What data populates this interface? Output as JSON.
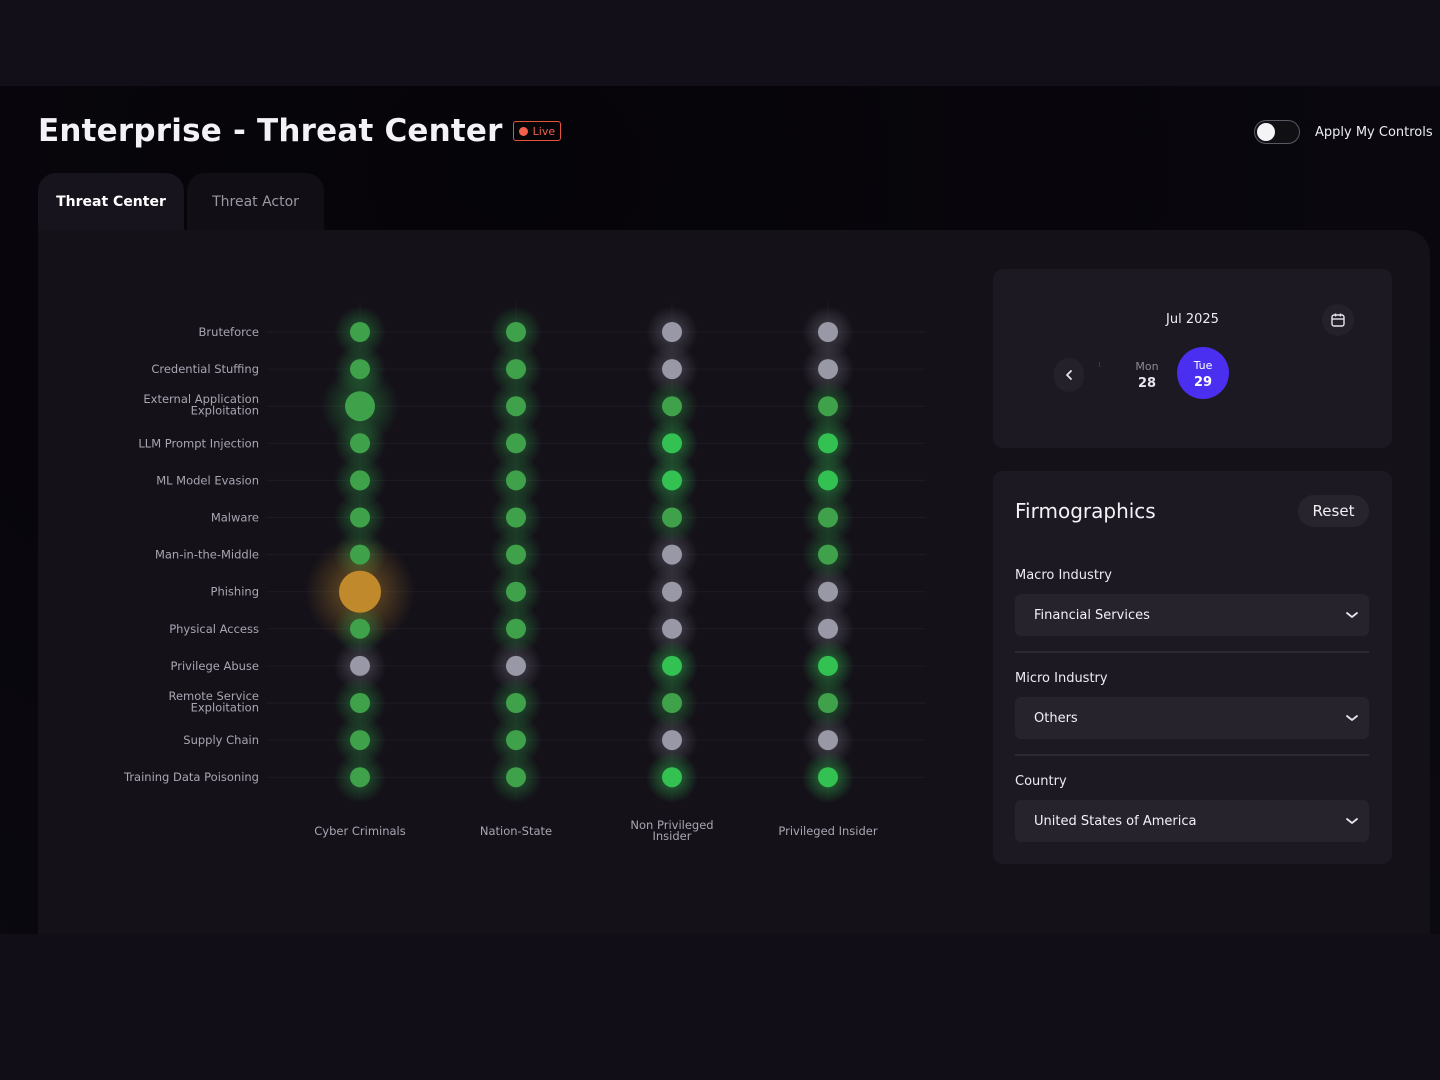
{
  "header": {
    "title": "Enterprise - Threat Center",
    "live_badge": "Live",
    "toggle_label": "Apply My Controls",
    "toggle_on": false
  },
  "tabs": [
    {
      "label": "Threat Center",
      "active": true
    },
    {
      "label": "Threat Actor",
      "active": false
    }
  ],
  "date_picker": {
    "month": "Jul 2025",
    "days": [
      {
        "name": "Mon",
        "num": "28",
        "selected": false
      },
      {
        "name": "Tue",
        "num": "29",
        "selected": true
      }
    ]
  },
  "firmographics": {
    "title": "Firmographics",
    "reset_label": "Reset",
    "fields": [
      {
        "label": "Macro Industry",
        "value": "Financial Services"
      },
      {
        "label": "Micro Industry",
        "value": "Others"
      },
      {
        "label": "Country",
        "value": "United States of America"
      }
    ]
  },
  "colors": {
    "green": "#3fa14a",
    "bright_green": "#33c152",
    "gray": "#9998a6",
    "amber": "#c08a2c",
    "accent": "#4a2ff0",
    "live": "#f0614a"
  },
  "chart_data": {
    "type": "scatter",
    "rows": [
      "Bruteforce",
      "Credential Stuffing",
      [
        "External Application",
        "Exploitation"
      ],
      "LLM Prompt Injection",
      "ML Model Evasion",
      "Malware",
      "Man-in-the-Middle",
      "Phishing",
      "Physical Access",
      "Privilege Abuse",
      [
        "Remote Service",
        "Exploitation"
      ],
      "Supply Chain",
      "Training Data Poisoning"
    ],
    "columns": [
      "Cyber Criminals",
      "Nation-State",
      [
        "Non Privileged",
        "Insider"
      ],
      "Privileged Insider"
    ],
    "cells": [
      [
        {
          "s": "green",
          "size": 1
        },
        {
          "s": "green",
          "size": 1
        },
        {
          "s": "gray",
          "size": 1
        },
        {
          "s": "gray",
          "size": 1
        }
      ],
      [
        {
          "s": "green",
          "size": 1
        },
        {
          "s": "green",
          "size": 1
        },
        {
          "s": "gray",
          "size": 1
        },
        {
          "s": "gray",
          "size": 1
        }
      ],
      [
        {
          "s": "green",
          "size": 1.5
        },
        {
          "s": "green",
          "size": 1
        },
        {
          "s": "green",
          "size": 1
        },
        {
          "s": "green",
          "size": 1
        }
      ],
      [
        {
          "s": "green",
          "size": 1
        },
        {
          "s": "green",
          "size": 1
        },
        {
          "s": "bright_green",
          "size": 1
        },
        {
          "s": "bright_green",
          "size": 1
        }
      ],
      [
        {
          "s": "green",
          "size": 1
        },
        {
          "s": "green",
          "size": 1
        },
        {
          "s": "bright_green",
          "size": 1
        },
        {
          "s": "bright_green",
          "size": 1
        }
      ],
      [
        {
          "s": "green",
          "size": 1
        },
        {
          "s": "green",
          "size": 1
        },
        {
          "s": "green",
          "size": 1
        },
        {
          "s": "green",
          "size": 1
        }
      ],
      [
        {
          "s": "green",
          "size": 1
        },
        {
          "s": "green",
          "size": 1
        },
        {
          "s": "gray",
          "size": 1
        },
        {
          "s": "green",
          "size": 1
        }
      ],
      [
        {
          "s": "amber",
          "size": 2.1
        },
        {
          "s": "green",
          "size": 1
        },
        {
          "s": "gray",
          "size": 1
        },
        {
          "s": "gray",
          "size": 1
        }
      ],
      [
        {
          "s": "green",
          "size": 1
        },
        {
          "s": "green",
          "size": 1
        },
        {
          "s": "gray",
          "size": 1
        },
        {
          "s": "gray",
          "size": 1
        }
      ],
      [
        {
          "s": "gray",
          "size": 1
        },
        {
          "s": "gray",
          "size": 1
        },
        {
          "s": "bright_green",
          "size": 1
        },
        {
          "s": "bright_green",
          "size": 1
        }
      ],
      [
        {
          "s": "green",
          "size": 1
        },
        {
          "s": "green",
          "size": 1
        },
        {
          "s": "green",
          "size": 1
        },
        {
          "s": "green",
          "size": 1
        }
      ],
      [
        {
          "s": "green",
          "size": 1
        },
        {
          "s": "green",
          "size": 1
        },
        {
          "s": "gray",
          "size": 1
        },
        {
          "s": "gray",
          "size": 1
        }
      ],
      [
        {
          "s": "green",
          "size": 1
        },
        {
          "s": "green",
          "size": 1
        },
        {
          "s": "bright_green",
          "size": 1
        },
        {
          "s": "bright_green",
          "size": 1
        }
      ]
    ]
  }
}
